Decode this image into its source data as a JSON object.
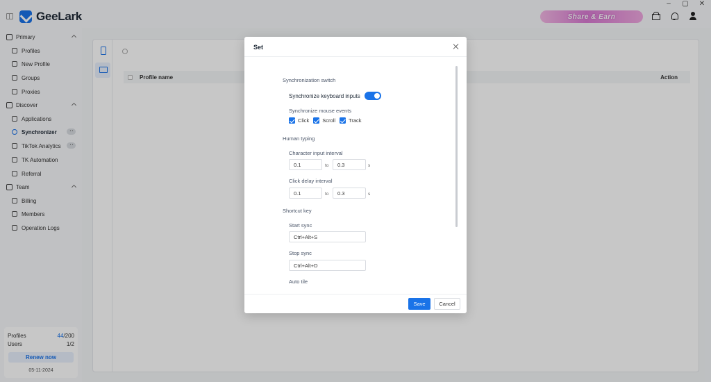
{
  "app": {
    "name": "GeeLark"
  },
  "window_controls": {
    "minimize": "–",
    "restore": "▢",
    "close": "✕"
  },
  "header": {
    "share_banner": "Share & Earn"
  },
  "sidebar": {
    "groups": [
      {
        "label": "Primary",
        "items": [
          {
            "label": "Profiles",
            "icon": "profiles-icon"
          },
          {
            "label": "New Profile",
            "icon": "new-profile-icon"
          },
          {
            "label": "Groups",
            "icon": "groups-icon"
          },
          {
            "label": "Proxies",
            "icon": "proxies-icon"
          }
        ]
      },
      {
        "label": "Discover",
        "items": [
          {
            "label": "Applications",
            "icon": "applications-icon"
          },
          {
            "label": "Synchronizer",
            "icon": "synchronizer-icon",
            "active": true
          },
          {
            "label": "TikTok Analytics",
            "icon": "analytics-icon"
          },
          {
            "label": "TK Automation",
            "icon": "tiktok-icon"
          },
          {
            "label": "Referral",
            "icon": "gift-icon"
          }
        ]
      },
      {
        "label": "Team",
        "items": [
          {
            "label": "Billing",
            "icon": "billing-icon"
          },
          {
            "label": "Members",
            "icon": "members-icon"
          },
          {
            "label": "Operation Logs",
            "icon": "logs-icon"
          }
        ]
      }
    ],
    "footer": {
      "profiles_label": "Profiles",
      "profiles_used": "44",
      "profiles_total": "/200",
      "users_label": "Users",
      "users_value": "1/2",
      "renew_label": "Renew now",
      "date": "05-11-2024"
    }
  },
  "main": {
    "table": {
      "col_name": "Profile name",
      "col_action": "Action"
    }
  },
  "modal": {
    "title": "Set",
    "sync_section": "Synchronization switch",
    "sync_keyboard_label": "Synchronize keyboard inputs",
    "sync_keyboard_on": true,
    "sync_mouse_label": "Synchronize mouse events",
    "mouse_events": [
      {
        "label": "Click",
        "checked": true
      },
      {
        "label": "Scroll",
        "checked": true
      },
      {
        "label": "Track",
        "checked": true
      }
    ],
    "human_typing_section": "Human typing",
    "char_interval_label": "Character input interval",
    "char_min": "0.1",
    "char_max": "0.3",
    "click_delay_label": "Click delay interval",
    "click_min": "0.1",
    "click_max": "0.3",
    "to_label": "to",
    "unit_label": "s",
    "shortcut_section": "Shortcut key",
    "start_sync_label": "Start sync",
    "start_sync_value": "Ctrl+Alt+S",
    "stop_sync_label": "Stop sync",
    "stop_sync_value": "Ctrl+Alt+D",
    "auto_tile_label": "Auto tile",
    "save_label": "Save",
    "cancel_label": "Cancel"
  },
  "colors": {
    "accent": "#1a73e8",
    "overlay": "rgba(0,0,0,0.22)"
  }
}
